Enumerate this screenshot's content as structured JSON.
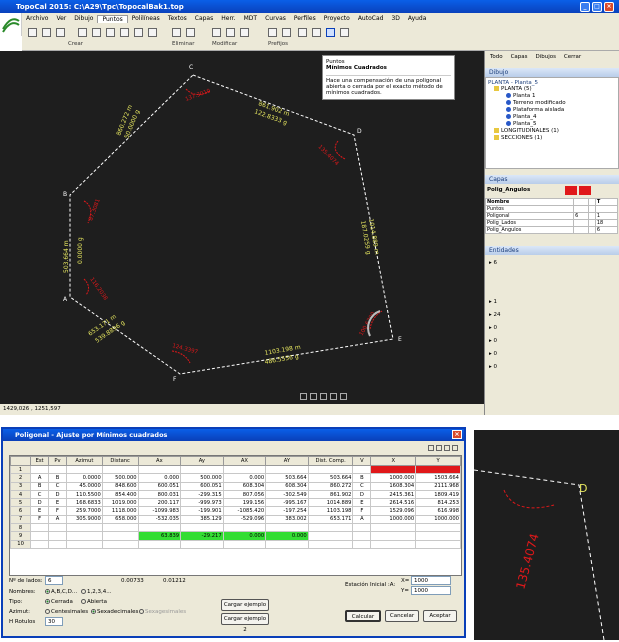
{
  "window": {
    "title": "TopoCal 2015: C:\\A29\\Tpc\\TopocalBak1.top"
  },
  "menu": [
    "Archivo",
    "Ver",
    "Dibujo",
    "Puntos",
    "Polilíneas",
    "Textos",
    "Capas",
    "Herr.",
    "MDT",
    "Curvas",
    "Perfiles",
    "Proyecto",
    "AutoCad",
    "3D",
    "Ayuda"
  ],
  "ribbon_groups": [
    "Crear",
    "Eliminar",
    "Modificar",
    "Prefijos"
  ],
  "tooltip": {
    "title": "Puntos",
    "subtitle": "Mínimos Cuadrados",
    "text": "Hace una compensación de una poligonal abierta o cerrada por el exacto método de mínimos cuadrados."
  },
  "canvas": {
    "points": [
      "A",
      "B",
      "C",
      "D",
      "E",
      "F"
    ],
    "dist_labels": [
      "860.272 m",
      "861.902 m",
      "1014.889 m",
      "1103.198 m",
      "653.171 m",
      "503.664 m"
    ],
    "azimut_labels": [
      "50.0000 g",
      "122.8333 g",
      "187.0259 g",
      "486.5556 g",
      "539.8896 g",
      "0.0000 g"
    ],
    "angle_labels": [
      "87.3081",
      "137.3010",
      "135.4074",
      "100.6700",
      "124.3397",
      "116.2038"
    ]
  },
  "status": {
    "coords": "1429,026 , 1251,597"
  },
  "panel": {
    "tabs": [
      "Todo",
      "Capas",
      "Dibujos",
      "Cerrar"
    ],
    "dibujo_section": "Dibujo",
    "planta_label": "PLANTA - Planta_5",
    "tree": [
      "PLANTA (5)",
      "Planta 1",
      "Terreno modificado",
      "Plataforma aislada",
      "Planta_4",
      "Planta_5",
      "LONGITUDINALES (1)",
      "SECCIONES (1)"
    ],
    "capas_section": "Capas",
    "active_layer": "Polig_Angulos",
    "layers_header": [
      "Nombre",
      "T"
    ],
    "layers": [
      {
        "name": "Puntos",
        "a": "",
        "b": ""
      },
      {
        "name": "Poligonal",
        "a": "6",
        "b": "1"
      },
      {
        "name": "Polig_Lados",
        "a": "",
        "b": "18"
      },
      {
        "name": "Polig_Angulos",
        "a": "",
        "b": "6"
      }
    ],
    "entidades_section": "Entidades",
    "entity_counts": [
      "6",
      "1",
      "24",
      "0",
      "0",
      "0",
      "0",
      "0"
    ]
  },
  "dialog": {
    "title": "Poligonal - Ajuste por Mínimos cuadrados",
    "headers": [
      "",
      "Est",
      "Pv",
      "Azimut",
      "Distanc",
      "Ax",
      "Ay",
      "AX",
      "AY",
      "Dist. Comp.",
      "V",
      "X",
      "Y"
    ],
    "rows": [
      [
        "1",
        "",
        "",
        "",
        "",
        "",
        "",
        "",
        "",
        "",
        "",
        "",
        ""
      ],
      [
        "2",
        "A",
        "B",
        "0.0000",
        "500.000",
        "0.000",
        "500.000",
        "0.000",
        "503.664",
        "503.664",
        "B",
        "1000.000",
        "1503.664"
      ],
      [
        "3",
        "B",
        "C",
        "45.0000",
        "848.600",
        "600.051",
        "600.051",
        "608.304",
        "608.304",
        "860.272",
        "C",
        "1608.304",
        "2111.968"
      ],
      [
        "4",
        "C",
        "D",
        "110.5500",
        "854.400",
        "800.031",
        "-299.315",
        "807.056",
        "-302.549",
        "861.902",
        "D",
        "2415.361",
        "1809.419"
      ],
      [
        "5",
        "D",
        "E",
        "168.6833",
        "1019.000",
        "200.117",
        "-999.973",
        "199.156",
        "-995.167",
        "1014.889",
        "E",
        "2614.516",
        "814.253"
      ],
      [
        "6",
        "E",
        "F",
        "259.7000",
        "1118.000",
        "-1099.983",
        "-199.901",
        "-1085.420",
        "-197.254",
        "1103.198",
        "F",
        "1529.096",
        "616.998"
      ],
      [
        "7",
        "F",
        "A",
        "305.9000",
        "658.000",
        "-532.035",
        "385.129",
        "-529.096",
        "383.002",
        "653.171",
        "A",
        "1000.000",
        "1000.000"
      ],
      [
        "8",
        "",
        "",
        "",
        "",
        "",
        "",
        "",
        "",
        "",
        "",
        "",
        ""
      ],
      [
        "9",
        "",
        "",
        "",
        "",
        "63.839",
        "-29.217",
        "0.000",
        "0.000",
        "",
        "",
        "",
        ""
      ],
      [
        "10",
        "",
        "",
        "",
        "",
        "",
        "",
        "",
        "",
        "",
        "",
        "",
        ""
      ]
    ],
    "n_lados_label": "Nº de lados:",
    "n_lados": "6",
    "stat1": "0.00733",
    "stat2": "0.01212",
    "nombres_label": "Nombres:",
    "nombres_opts": [
      "A,B,C,D...",
      "1,2,3,4..."
    ],
    "tipo_label": "Tipo:",
    "tipo_opts": [
      "Cerrada",
      "Abierta"
    ],
    "azimut_label": "Azimut:",
    "azimut_opts": [
      "Centesimales",
      "Sexadecimales",
      "Sexagesimales"
    ],
    "hrot_label": "H Rotulos",
    "hrot": "30",
    "estacion_label": "Estación Inicial :A:",
    "x_label": "X=",
    "x_val": "1000",
    "y_label": "Y=",
    "y_val": "1000",
    "btn_ej1": "Cargar ejemplo 1",
    "btn_ej2": "Cargar ejemplo 2",
    "btn_calc": "Calcular",
    "btn_cancel": "Cancelar",
    "btn_ok": "Aceptar"
  },
  "zoom": {
    "point_label": "D",
    "angle_label": "135.4074"
  },
  "colors": {
    "accent": "#0a3fb8",
    "angle_red": "#e0181a",
    "line_white": "#ffffff",
    "dist_yellow": "#e8e860",
    "highlight_green": "#33dd33"
  }
}
